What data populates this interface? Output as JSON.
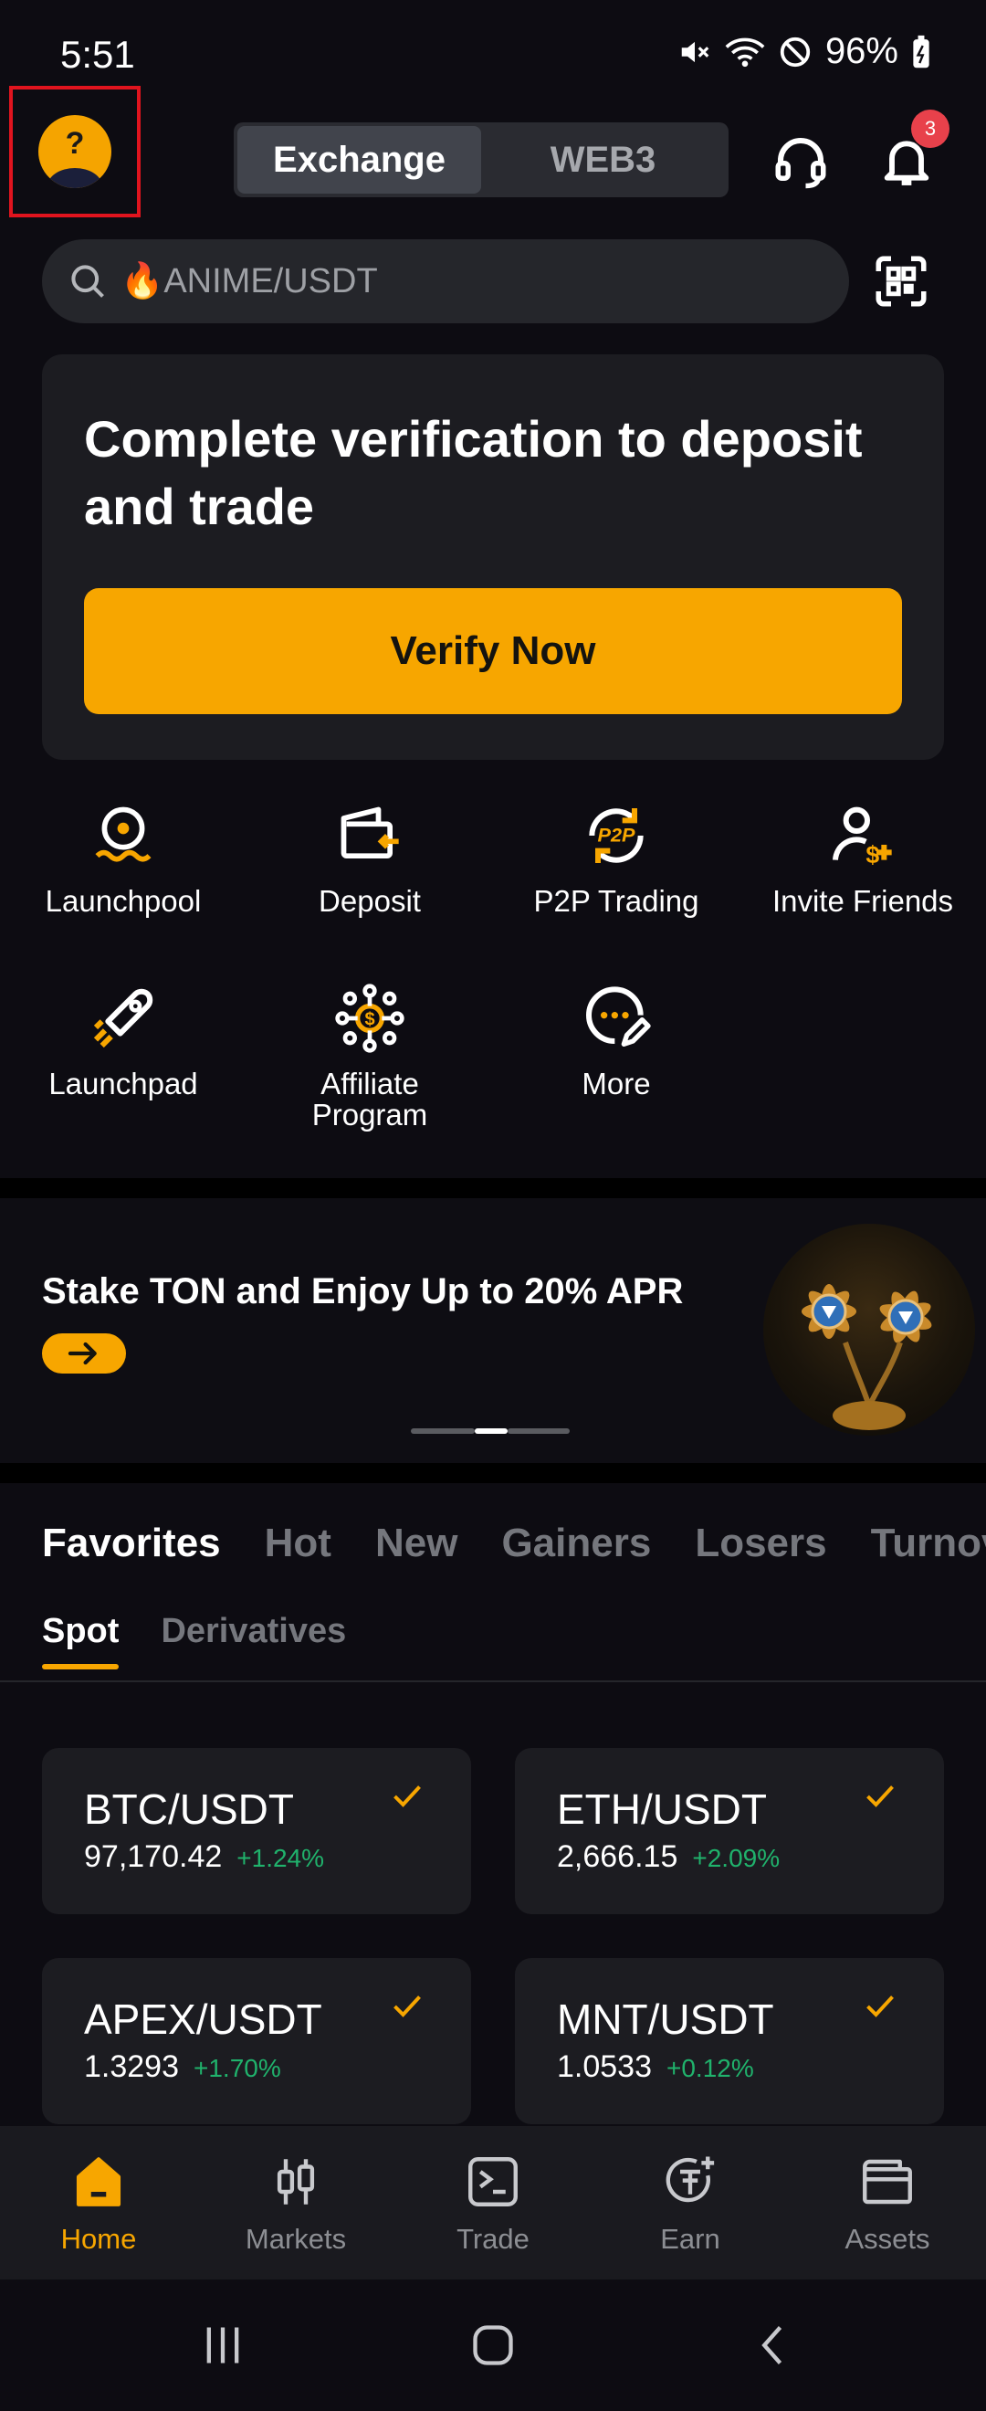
{
  "status_bar": {
    "time": "5:51",
    "battery": "96%"
  },
  "header": {
    "avatar_glyph": "?",
    "segments": [
      {
        "label": "Exchange",
        "active": true
      },
      {
        "label": "WEB3",
        "active": false
      }
    ],
    "notification_count": "3"
  },
  "search": {
    "placeholder": "🔥ANIME/USDT"
  },
  "verify": {
    "title": "Complete verification to deposit and trade",
    "button_label": "Verify Now"
  },
  "shortcuts": [
    {
      "label": "Launchpool",
      "icon": "launchpool-icon"
    },
    {
      "label": "Deposit",
      "icon": "deposit-icon"
    },
    {
      "label": "P2P Trading",
      "icon": "p2p-icon"
    },
    {
      "label": "Invite Friends",
      "icon": "invite-icon"
    },
    {
      "label": "Launchpad",
      "icon": "rocket-icon"
    },
    {
      "label": "Affiliate Program",
      "icon": "affiliate-icon"
    },
    {
      "label": "More",
      "icon": "more-icon"
    }
  ],
  "banner": {
    "title": "Stake TON and Enjoy Up to 20% APR"
  },
  "market_tabs": [
    "Favorites",
    "Hot",
    "New",
    "Gainers",
    "Losers",
    "Turnov"
  ],
  "market_subtabs": [
    "Spot",
    "Derivatives"
  ],
  "pairs": [
    {
      "name": "BTC/USDT",
      "price": "97,170.42",
      "change": "+1.24%"
    },
    {
      "name": "ETH/USDT",
      "price": "2,666.15",
      "change": "+2.09%"
    },
    {
      "name": "APEX/USDT",
      "price": "1.3293",
      "change": "+1.70%"
    },
    {
      "name": "MNT/USDT",
      "price": "1.0533",
      "change": "+0.12%"
    }
  ],
  "bottom_nav": [
    {
      "label": "Home",
      "active": true
    },
    {
      "label": "Markets",
      "active": false
    },
    {
      "label": "Trade",
      "active": false
    },
    {
      "label": "Earn",
      "active": false
    },
    {
      "label": "Assets",
      "active": false
    }
  ],
  "colors": {
    "accent": "#f7a600",
    "positive": "#20b26c",
    "badge": "#e8414b",
    "background": "#0d0c12"
  }
}
